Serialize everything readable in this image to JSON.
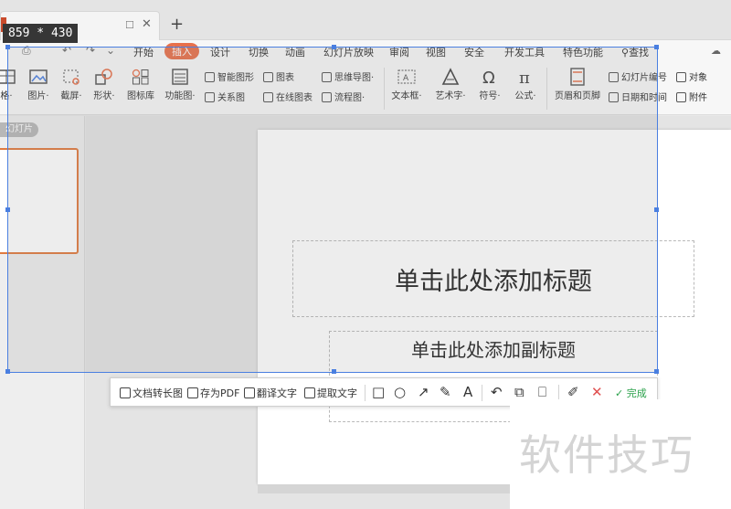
{
  "tabbar": {
    "pin_glyph": "☐",
    "close_glyph": "✕",
    "new_tab_glyph": "+"
  },
  "quick_access": {
    "items": [
      "⎙",
      "↶",
      "↷",
      "⌄"
    ]
  },
  "menu": {
    "items": [
      "开始",
      "插入",
      "设计",
      "切换",
      "动画",
      "幻灯片放映",
      "审阅",
      "视图",
      "安全",
      "开发工具",
      "特色功能"
    ],
    "search_label": "查找",
    "active_index": 1,
    "accent": "#e8704b"
  },
  "ribbon": {
    "big": [
      {
        "label": "格·"
      },
      {
        "label": "图片·"
      },
      {
        "label": "截屏·"
      },
      {
        "label": "形状·"
      },
      {
        "label": "图标库"
      },
      {
        "label": "功能图·"
      },
      {
        "label": "文本框·"
      },
      {
        "label": "艺术字·"
      },
      {
        "label": "符号·"
      },
      {
        "label": "公式·"
      },
      {
        "label": "页眉和页脚"
      }
    ],
    "small": [
      {
        "label": "智能图形"
      },
      {
        "label": "关系图"
      },
      {
        "label": "图表"
      },
      {
        "label": "在线图表"
      },
      {
        "label": "思维导图·"
      },
      {
        "label": "流程图·"
      },
      {
        "label": "幻灯片编号"
      },
      {
        "label": "日期和时间"
      },
      {
        "label": "对象"
      },
      {
        "label": "附件"
      }
    ]
  },
  "left_pane": {
    "slide_label": "幻灯片"
  },
  "slide": {
    "title_placeholder": "单击此处添加标题",
    "subtitle_placeholder": "单击此处添加副标题"
  },
  "capture": {
    "dimensions": "859 * 430",
    "tools": [
      {
        "label": "文档转长图"
      },
      {
        "label": "存为PDF"
      },
      {
        "label": "翻译文字"
      },
      {
        "label": "提取文字"
      }
    ],
    "draw_icons": [
      "□",
      "○",
      "↗",
      "✎",
      "A",
      "↶",
      "⧉",
      "⎕",
      "✐",
      "✕"
    ],
    "done_label": "完成",
    "accent": "#4a7fe0",
    "done_color": "#2aa14a"
  },
  "watermark": {
    "text": "软件技巧"
  }
}
